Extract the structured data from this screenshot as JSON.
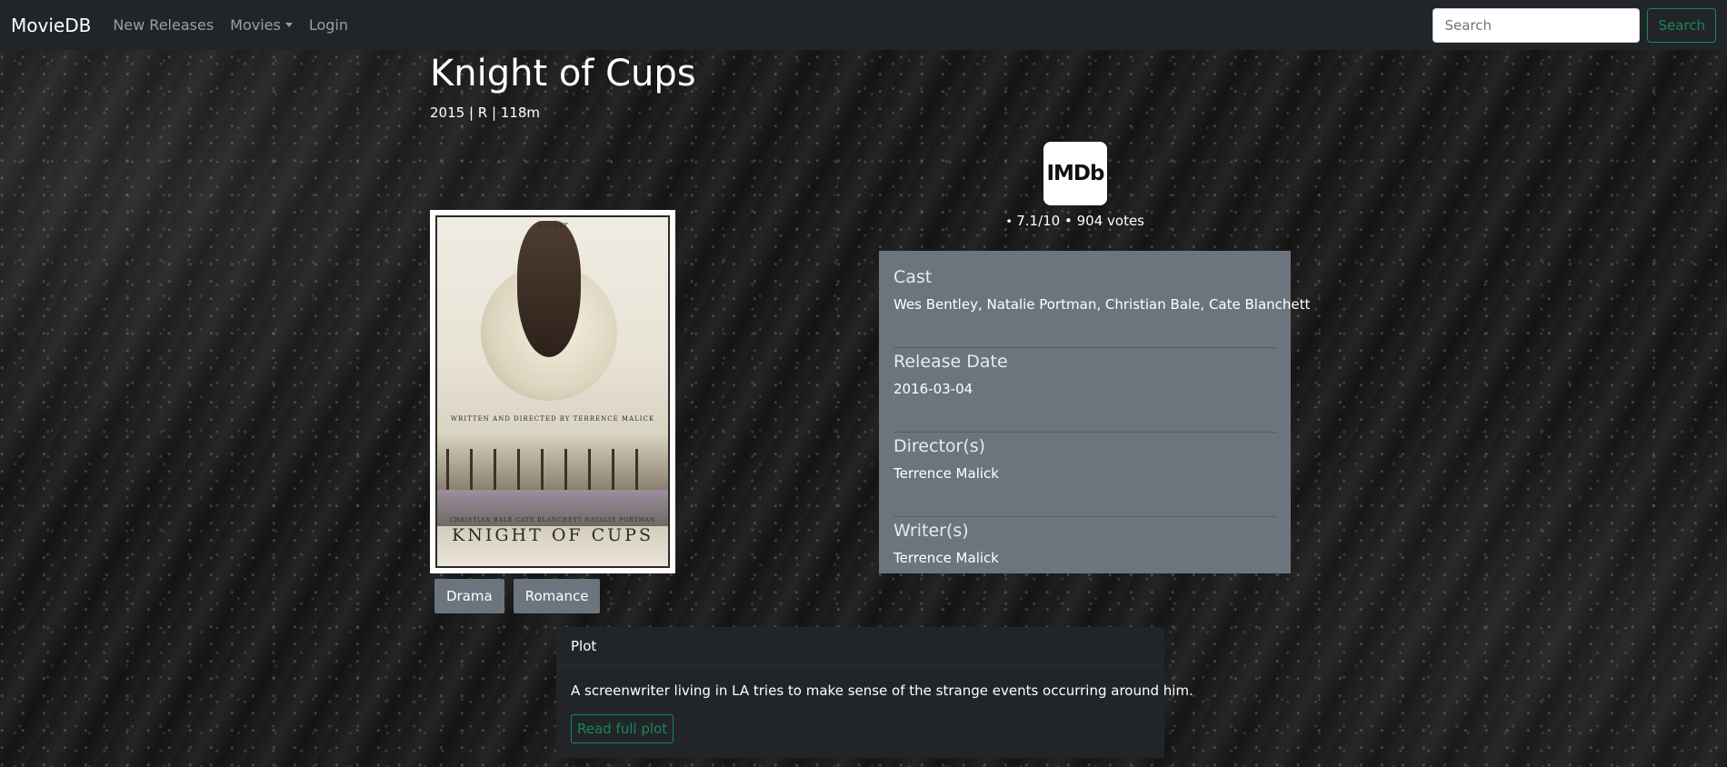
{
  "navbar": {
    "brand": "MovieDB",
    "links": [
      "New Releases",
      "Movies",
      "Login"
    ],
    "search_placeholder": "Search",
    "search_button": "Search"
  },
  "movie": {
    "title": "Knight of Cups",
    "meta": "2015 | R | 118m",
    "genres": [
      "Drama",
      "Romance"
    ]
  },
  "poster": {
    "top_text": "A QUEST",
    "credit_text": "WRITTEN AND DIRECTED BY TERRENCE MALICK",
    "cast_text": "CHRISTIAN BALE   CATE BLANCHETT   NATALIE PORTMAN",
    "title_text": "KNIGHT OF CUPS"
  },
  "imdb": {
    "logo_text": "IMDb",
    "rating_text": "7.1/10 • 904 votes"
  },
  "info": {
    "cast_heading": "Cast",
    "cast_value": "Wes Bentley, Natalie Portman, Christian Bale, Cate Blanchett",
    "release_heading": "Release Date",
    "release_value": "2016-03-04",
    "director_heading": "Director(s)",
    "director_value": "Terrence Malick",
    "writer_heading": "Writer(s)",
    "writer_value": "Terrence Malick"
  },
  "plot": {
    "header": "Plot",
    "text": "A screenwriter living in LA tries to make sense of the strange events occurring around him.",
    "button": "Read full plot"
  },
  "colors": {
    "navbar_bg": "#212529",
    "accent_green": "#198754",
    "card_gray": "#6c757d"
  }
}
